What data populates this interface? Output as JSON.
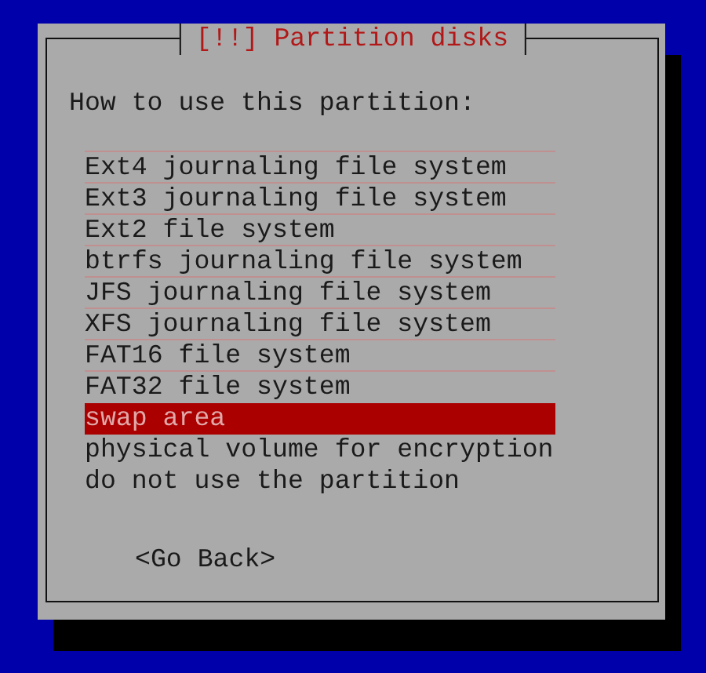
{
  "dialog": {
    "title": "[!!] Partition disks",
    "prompt": "How to use this partition:",
    "options": [
      {
        "label": "Ext4 journaling file system",
        "selected": false
      },
      {
        "label": "Ext3 journaling file system",
        "selected": false
      },
      {
        "label": "Ext2 file system",
        "selected": false
      },
      {
        "label": "btrfs journaling file system",
        "selected": false
      },
      {
        "label": "JFS journaling file system",
        "selected": false
      },
      {
        "label": "XFS journaling file system",
        "selected": false
      },
      {
        "label": "FAT16 file system",
        "selected": false
      },
      {
        "label": "FAT32 file system",
        "selected": false
      },
      {
        "label": "swap area",
        "selected": true
      },
      {
        "label": "physical volume for encryption",
        "selected": false
      },
      {
        "label": "do not use the partition",
        "selected": false
      }
    ],
    "buttons": [
      {
        "label": "<Go Back>"
      }
    ]
  }
}
